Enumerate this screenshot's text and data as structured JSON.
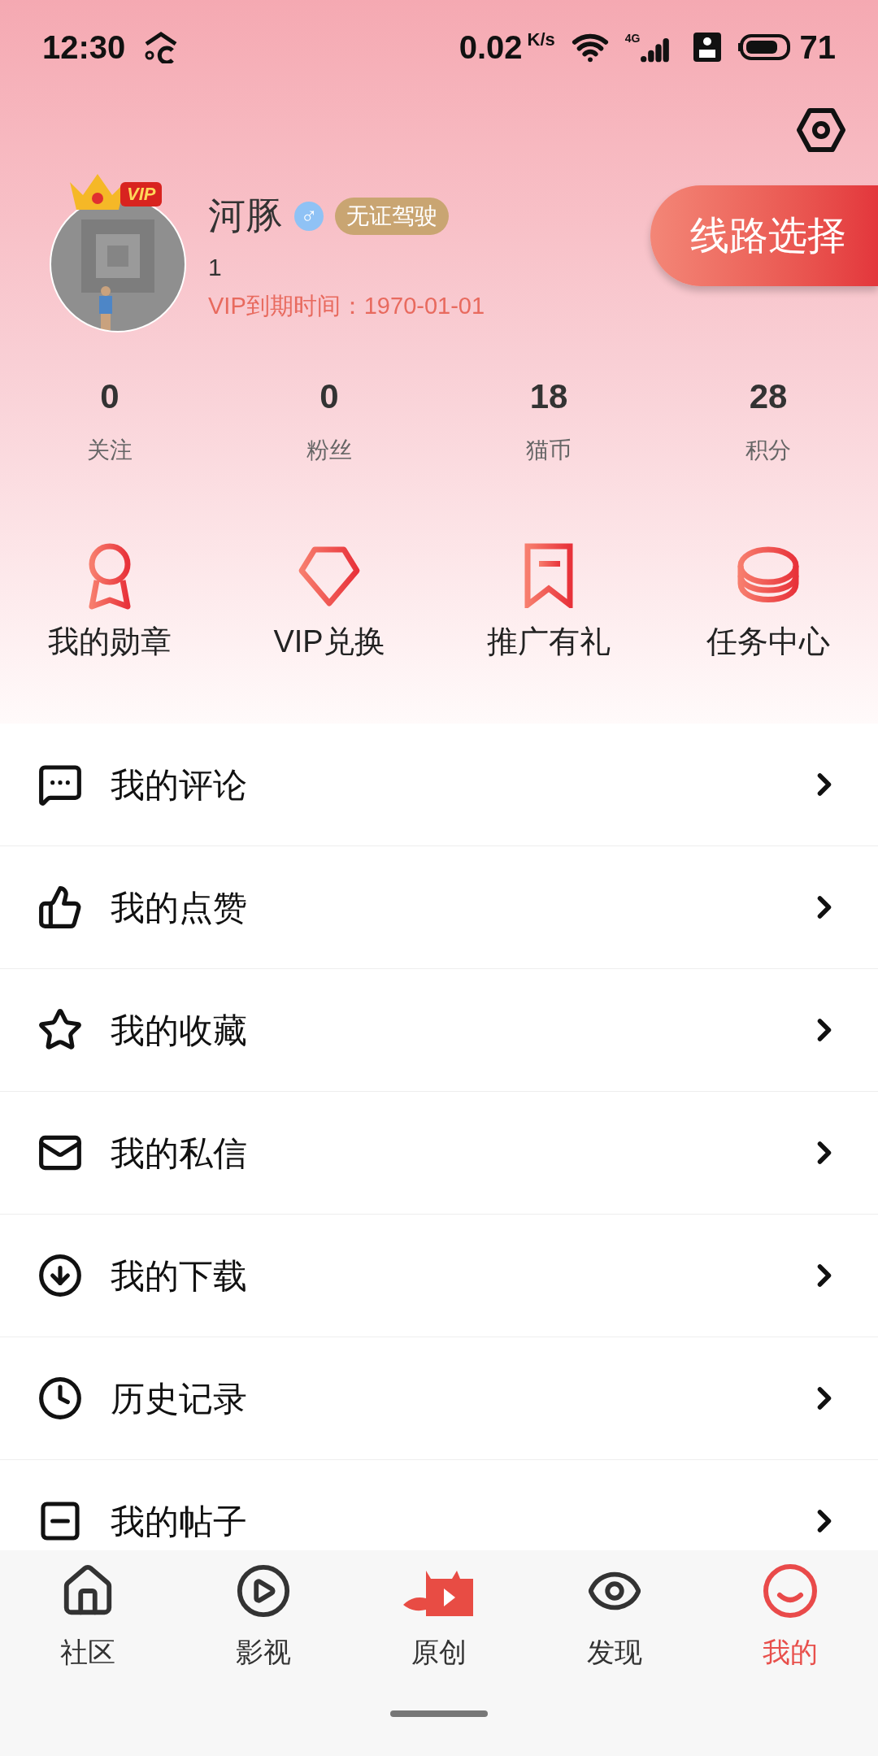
{
  "status_bar": {
    "time": "12:30",
    "speed": "0.02",
    "speed_unit": "K/s",
    "network": "4G",
    "battery": "71"
  },
  "profile": {
    "vip_badge": "VIP",
    "name": "河豚",
    "gender": "♂",
    "tag": "无证驾驶",
    "id": "1",
    "vip_expiry": "VIP到期时间：1970-01-01",
    "route_button": "线路选择"
  },
  "stats": [
    {
      "value": "0",
      "label": "关注"
    },
    {
      "value": "0",
      "label": "粉丝"
    },
    {
      "value": "18",
      "label": "猫币"
    },
    {
      "value": "28",
      "label": "积分"
    }
  ],
  "shortcuts": [
    {
      "kind": "medal",
      "label": "我的勋章"
    },
    {
      "kind": "diamond",
      "label": "VIP兑换"
    },
    {
      "kind": "bookmark",
      "label": "推广有礼"
    },
    {
      "kind": "coins",
      "label": "任务中心"
    }
  ],
  "menu": [
    {
      "kind": "comment",
      "label": "我的评论"
    },
    {
      "kind": "like",
      "label": "我的点赞"
    },
    {
      "kind": "star",
      "label": "我的收藏"
    },
    {
      "kind": "mail",
      "label": "我的私信"
    },
    {
      "kind": "download",
      "label": "我的下载"
    },
    {
      "kind": "history",
      "label": "历史记录"
    },
    {
      "kind": "post",
      "label": "我的帖子"
    }
  ],
  "bottom_nav": [
    {
      "kind": "home",
      "label": "社区",
      "selected": false
    },
    {
      "kind": "play",
      "label": "影视",
      "selected": false
    },
    {
      "kind": "cat",
      "label": "原创",
      "selected": false
    },
    {
      "kind": "eye",
      "label": "发现",
      "selected": false
    },
    {
      "kind": "smile",
      "label": "我的",
      "selected": true
    }
  ]
}
